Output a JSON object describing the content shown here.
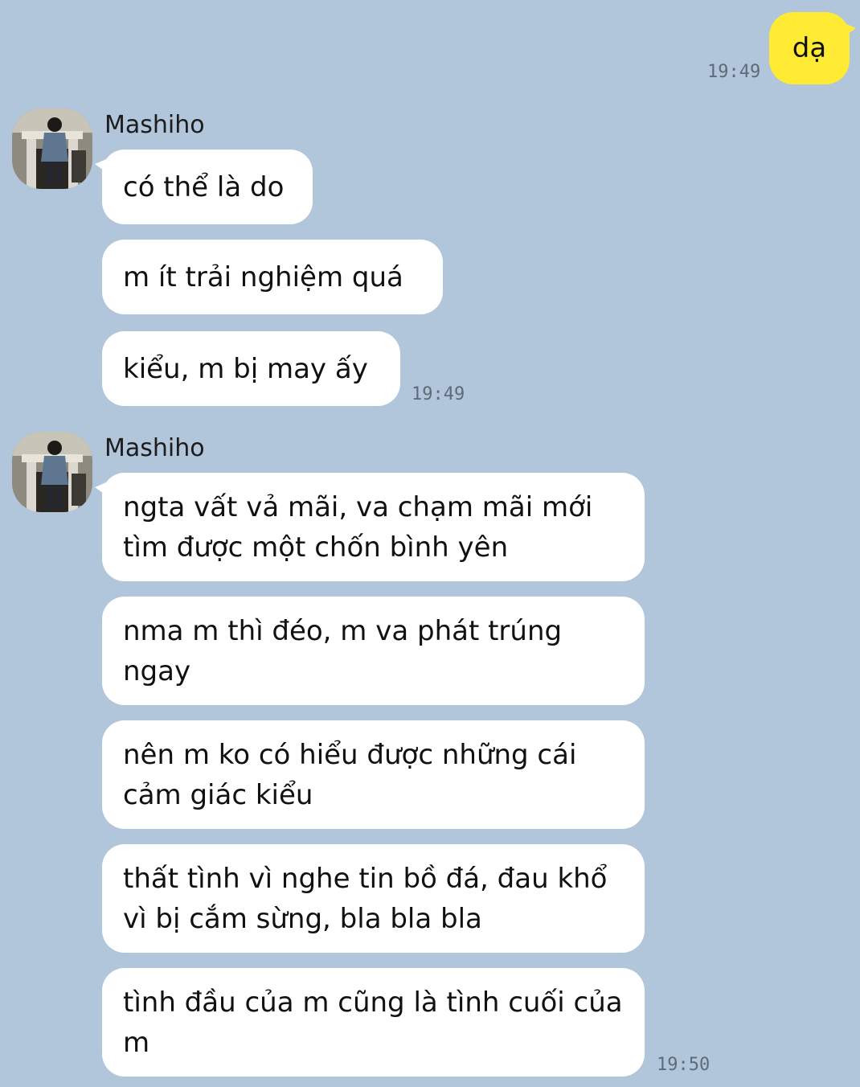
{
  "colors": {
    "background": "#b1c6da",
    "outgoing_bubble": "#ffeb33",
    "incoming_bubble": "#ffffff",
    "timestamp": "#5e6b78"
  },
  "messages": {
    "outgoing_1": {
      "text": "dạ",
      "time": "19:49"
    },
    "group_1": {
      "sender": "Mashiho",
      "avatar_icon": "user-avatar-photo",
      "bubbles": [
        "có thể là do",
        "m ít trải nghiệm quá",
        "kiểu, m bị may ấy"
      ],
      "time": "19:49"
    },
    "group_2": {
      "sender": "Mashiho",
      "avatar_icon": "user-avatar-photo",
      "bubbles": [
        "ngta vất vả mãi, va chạm mãi mới tìm được một chốn bình yên",
        "nma m thì đéo, m va phát trúng ngay",
        "nên m ko có hiểu được những cái cảm giác kiểu",
        "thất tình vì nghe tin bồ đá, đau khổ vì bị cắm sừng, bla bla bla",
        "tình đầu của m cũng là tình cuối của m"
      ],
      "time": "19:50"
    }
  }
}
